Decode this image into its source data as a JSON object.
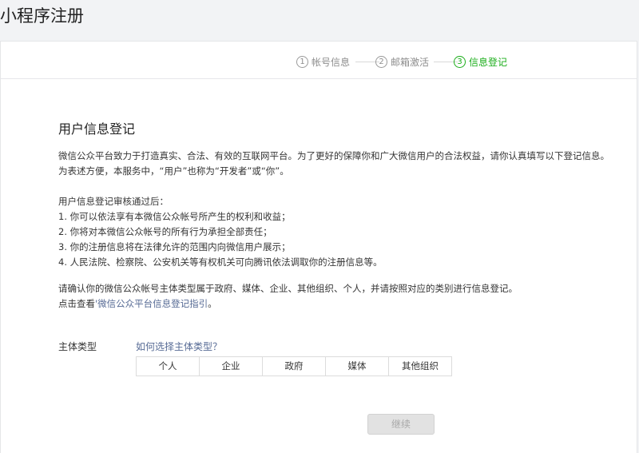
{
  "page": {
    "title": "小程序注册"
  },
  "steps": [
    {
      "num": "1",
      "label": "帐号信息"
    },
    {
      "num": "2",
      "label": "邮箱激活"
    },
    {
      "num": "3",
      "label": "信息登记"
    }
  ],
  "colors": {
    "accent": "#1aad19",
    "link": "#576b95"
  },
  "section": {
    "title": "用户信息登记",
    "intro_line1": "微信公众平台致力于打造真实、合法、有效的互联网平台。为了更好的保障你和广大微信用户的合法权益，请你认真填写以下登记信息。",
    "intro_line2": "为表述方便，本服务中，“用户”也称为“开发者”或“你”。",
    "review_heading": "用户信息登记审核通过后：",
    "review_items": [
      "1. 你可以依法享有本微信公众帐号所产生的权利和收益；",
      "2. 你将对本微信公众帐号的所有行为承担全部责任；",
      "3. 你的注册信息将在法律允许的范围内向微信用户展示；",
      "4. 人民法院、检察院、公安机关等有权机关可向腾讯依法调取你的注册信息等。"
    ],
    "confirm_line": "请确认你的微信公众帐号主体类型属于政府、媒体、企业、其他组织、个人，并请按照对应的类别进行信息登记。",
    "guide_prefix": "点击查看",
    "guide_link": "'微信公众平台信息登记指引",
    "guide_suffix": "。"
  },
  "form": {
    "subject_type_label": "主体类型",
    "subject_type_help": "如何选择主体类型？",
    "subject_types": [
      "个人",
      "企业",
      "政府",
      "媒体",
      "其他组织"
    ],
    "continue_label": "继续"
  }
}
